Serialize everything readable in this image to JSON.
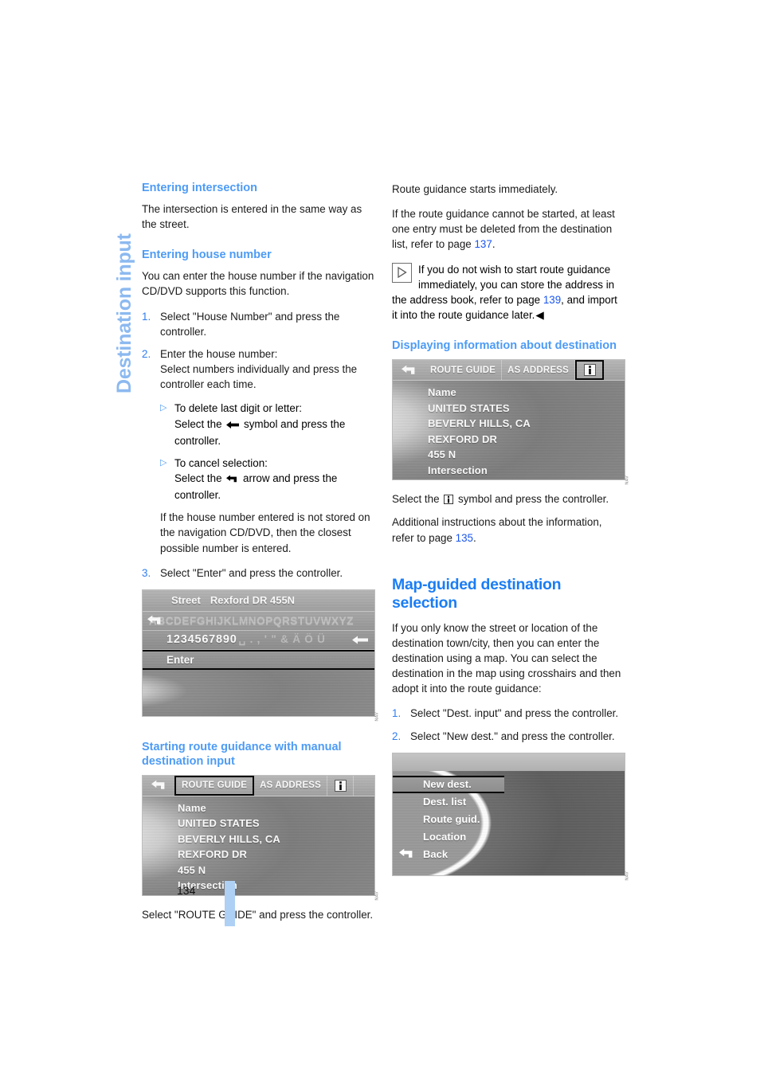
{
  "chapter": {
    "title": "Destination input"
  },
  "page": {
    "number": "134"
  },
  "colors": {
    "accent_heading": "#1a7df5",
    "sub_heading": "#4d9bf5",
    "page_ref": "#1a56f0",
    "chapter_tab": "#8cb9f0",
    "folio_bar": "#afd0f5"
  },
  "left_column": {
    "heading_intersection": "Entering intersection",
    "para_intersection": "The intersection is entered in the same way as the street.",
    "heading_house_number": "Entering house number",
    "para_house_number": "You can enter the house number if the navigation CD/DVD supports this function.",
    "steps": [
      {
        "num": "1.",
        "text": "Select \"House Number\" and press the controller."
      },
      {
        "num": "2.",
        "text": "Enter the house number:\nSelect numbers individually and press the controller each time."
      }
    ],
    "substeps": [
      {
        "bullet": "▷",
        "line1": "To delete last digit or letter:",
        "line2_pre": "Select the",
        "line2_post": "symbol and press the controller.",
        "icon": "delete-arrow-icon"
      },
      {
        "bullet": "▷",
        "line1": "To cancel selection:",
        "line2_pre": "Select the",
        "line2_post": "arrow and press the controller.",
        "icon": "back-arrow-icon"
      }
    ],
    "para_not_stored": "If the house number entered is not stored on the navigation CD/DVD, then the closest possible number is entered.",
    "step_enter": {
      "num": "3.",
      "text": "Select \"Enter\" and press the controller."
    },
    "heading_starting_route": "Starting route guidance with manual destination input",
    "caption_route_guide": "Select \"ROUTE GUIDE\" and press the controller."
  },
  "right_column": {
    "para_starts_immediately": "Route guidance starts immediately.",
    "para_cannot_start_pre": "If the route guidance cannot be started, at least one entry must be deleted from the destination list, refer to page ",
    "para_cannot_start_ref": "137",
    "para_cannot_start_post": ".",
    "note": {
      "icon": "triangle-note-icon",
      "text_pre": "If you do not wish to start route guidance immediately, you can store the address in the address book, refer to page ",
      "ref": "139",
      "text_post": ", and import it into the route guidance later.",
      "end_marker": "◀"
    },
    "heading_displaying_info": "Displaying information about destination",
    "caption_info_pre": "Select the",
    "caption_info_post": "symbol and press the controller.",
    "caption_info_icon": "info-icon",
    "para_additional_pre": "Additional instructions about the information, refer to page ",
    "para_additional_ref": "135",
    "para_additional_post": ".",
    "heading_map_guided": "Map-guided destination selection",
    "para_map_guided": "If you only know the street or location of the destination town/city, then you can enter the destination using a map. You can select the destination in the map using crosshairs and then adopt it into the route guidance:",
    "steps": [
      {
        "num": "1.",
        "text": "Select \"Dest. input\" and press the controller."
      },
      {
        "num": "2.",
        "text": "Select \"New dest.\" and press the controller."
      }
    ]
  },
  "screens": {
    "keyboard": {
      "field_label": "Street",
      "field_value": "Rexford DR 455N",
      "letters": "ABCDEFGHIJKLMNOPQRSTUVWXYZ",
      "numbers": "1234567890",
      "symbols": "␣ . , ' \" & Ä Ö Ü",
      "enter_label": "Enter",
      "back_icon": "back-arrow-icon",
      "delete_icon": "delete-arrow-icon"
    },
    "route_guide_list": {
      "back_icon": "back-arrow-icon",
      "tabs": [
        {
          "label": "ROUTE GUIDE",
          "selected": true
        },
        {
          "label": "AS ADDRESS",
          "selected": false
        }
      ],
      "info_icon": "info-icon",
      "info_selected": false,
      "lines": [
        "Name",
        "UNITED STATES",
        "BEVERLY HILLS, CA",
        "REXFORD DR",
        "455 N",
        "Intersection"
      ]
    },
    "info_list": {
      "back_icon": "back-arrow-icon",
      "tabs": [
        {
          "label": "ROUTE GUIDE",
          "selected": false
        },
        {
          "label": "AS ADDRESS",
          "selected": false
        }
      ],
      "info_icon": "info-icon",
      "info_selected": true,
      "lines": [
        "Name",
        "UNITED STATES",
        "BEVERLY HILLS, CA",
        "REXFORD DR",
        "455 N",
        "Intersection"
      ]
    },
    "dest_menu": {
      "items": [
        {
          "label": "New dest.",
          "selected": true,
          "icon": ""
        },
        {
          "label": "Dest. list",
          "selected": false,
          "icon": ""
        },
        {
          "label": "Route guid.",
          "selected": false,
          "icon": ""
        },
        {
          "label": "Location",
          "selected": false,
          "icon": ""
        },
        {
          "label": "Back",
          "selected": false,
          "icon": "back-arrow-icon"
        }
      ]
    }
  }
}
